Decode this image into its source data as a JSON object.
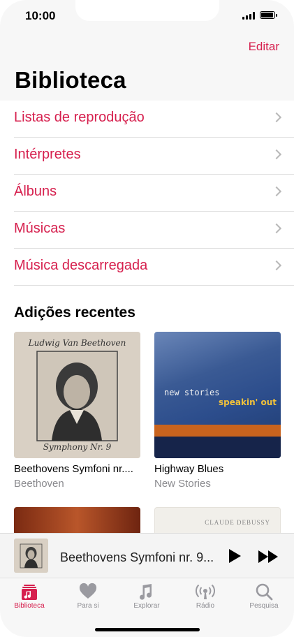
{
  "status": {
    "time": "10:00"
  },
  "header": {
    "edit_label": "Editar",
    "title": "Biblioteca"
  },
  "menu": [
    {
      "label": "Listas de reprodução"
    },
    {
      "label": "Intérpretes"
    },
    {
      "label": "Álbuns"
    },
    {
      "label": "Músicas"
    },
    {
      "label": "Música descarregada"
    }
  ],
  "recent": {
    "title": "Adições recentes",
    "albums": [
      {
        "name": "Beethovens Symfoni nr....",
        "artist": "Beethoven",
        "cover_text": "Ludwig Van Beethoven",
        "cover_bottom": "Symphony Nr. 9"
      },
      {
        "name": "Highway Blues",
        "artist": "New Stories",
        "cover_text": "new stories",
        "cover_accent": "speakin' out"
      },
      {
        "name": "",
        "artist": ""
      },
      {
        "name": "",
        "artist": "",
        "cover_text": "CLAUDE DEBUSSY"
      }
    ]
  },
  "mini_player": {
    "title": "Beethovens Symfoni nr. 9...",
    "art_text": "Ludwig Van Beethoven"
  },
  "tabbar": [
    {
      "label": "Biblioteca",
      "icon": "library-icon",
      "active": true
    },
    {
      "label": "Para si",
      "icon": "heart-icon",
      "active": false
    },
    {
      "label": "Explorar",
      "icon": "music-note-icon",
      "active": false
    },
    {
      "label": "Rádio",
      "icon": "radio-icon",
      "active": false
    },
    {
      "label": "Pesquisa",
      "icon": "search-icon",
      "active": false
    }
  ],
  "colors": {
    "accent": "#d6204e",
    "inactive": "#8e8e93"
  }
}
